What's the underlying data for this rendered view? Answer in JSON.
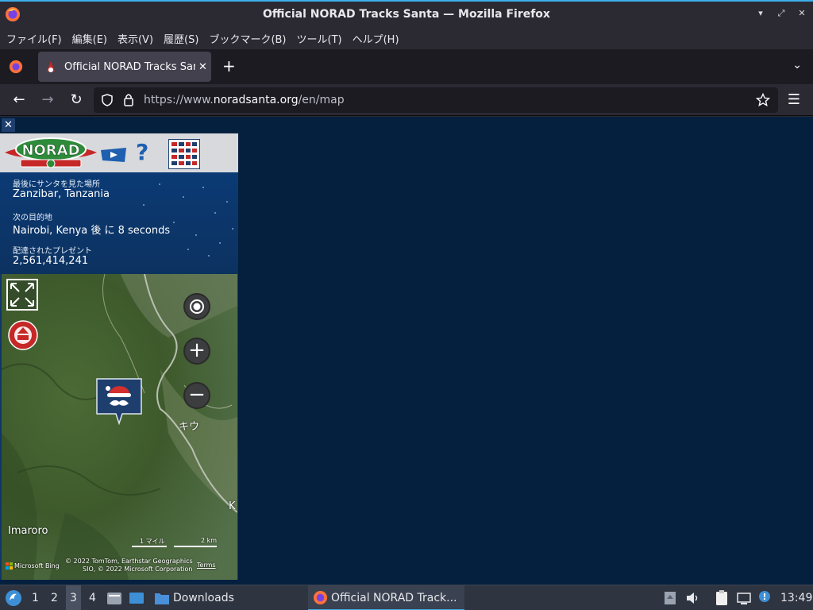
{
  "window": {
    "title": "Official NORAD Tracks Santa — Mozilla Firefox"
  },
  "menu": [
    "ファイル(F)",
    "編集(E)",
    "表示(V)",
    "履歴(S)",
    "ブックマーク(B)",
    "ツール(T)",
    "ヘルプ(H)"
  ],
  "tabs": {
    "active_title": "Official NORAD Tracks Santa",
    "close": "✕",
    "new_tab": "+"
  },
  "nav": {
    "url_prefix": "https://www.",
    "url_domain": "noradsanta.org",
    "url_path": "/en/map"
  },
  "panel": {
    "close_label": "✕",
    "help_label": "?",
    "last_seen_label": "最後にサンタを見た場所",
    "last_seen_value": "Zanzibar, Tanzania",
    "next_stop_label": "次の目的地",
    "next_stop_value": "Nairobi, Kenya 後 に 8 seconds",
    "presents_label": "配達されたプレゼント",
    "presents_value": "2,561,414,241"
  },
  "map": {
    "place_kiu": "キウ",
    "place_imaroro": "Imaroro",
    "place_k": "K",
    "scale_miles": "1 マイル",
    "scale_km": "2 km",
    "bing_label": "Microsoft Bing",
    "copyright_line1": "© 2022 TomTom, Earthstar Geographics",
    "copyright_line2": "SIO, © 2022 Microsoft Corporation",
    "terms": "Terms",
    "zoom_in": "+",
    "zoom_out": "−"
  },
  "taskbar": {
    "workspaces": [
      "1",
      "2",
      "3",
      "4"
    ],
    "active_workspace": "3",
    "downloads": "Downloads",
    "active_window": "Official NORAD Track...",
    "clock": "13:49"
  },
  "colors": {
    "page_bg": "#05203e",
    "panel_bg": "#0e3768",
    "accent": "#3daee9"
  }
}
